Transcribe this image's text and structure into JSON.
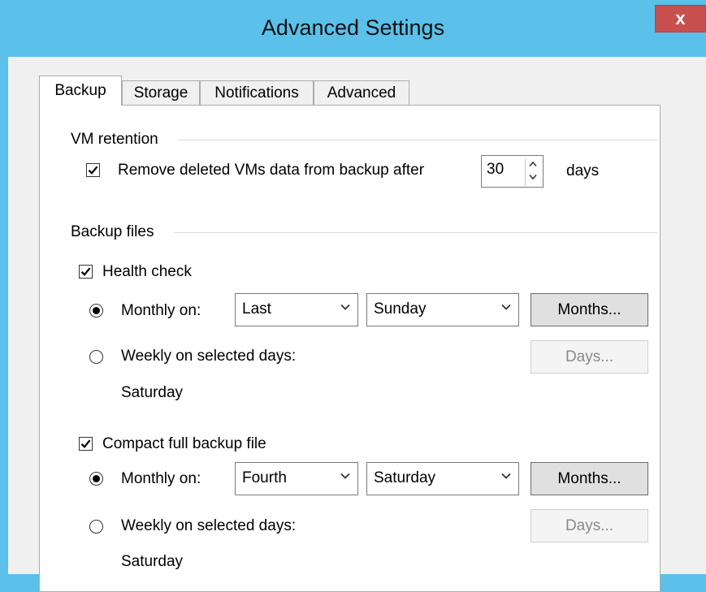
{
  "window": {
    "title": "Advanced Settings",
    "close_label": "x"
  },
  "tabs": [
    {
      "label": "Backup",
      "active": true
    },
    {
      "label": "Storage",
      "active": false
    },
    {
      "label": "Notifications",
      "active": false
    },
    {
      "label": "Advanced",
      "active": false
    }
  ],
  "vm_retention": {
    "group_label": "VM retention",
    "remove_deleted_label": "Remove deleted VMs data from backup after",
    "remove_deleted_checked": true,
    "days_value": "30",
    "days_unit": "days"
  },
  "backup_files": {
    "group_label": "Backup files",
    "health_check": {
      "label": "Health check",
      "checked": true,
      "monthly_label": "Monthly on:",
      "monthly_selected": true,
      "week_value": "Last",
      "day_value": "Sunday",
      "months_button": "Months...",
      "weekly_label": "Weekly on selected days:",
      "days_button": "Days...",
      "weekly_days_text": "Saturday"
    },
    "compact": {
      "label": "Compact full backup file",
      "checked": true,
      "monthly_label": "Monthly on:",
      "monthly_selected": true,
      "week_value": "Fourth",
      "day_value": "Saturday",
      "months_button": "Months...",
      "weekly_label": "Weekly on selected days:",
      "days_button": "Days...",
      "weekly_days_text": "Saturday"
    }
  }
}
